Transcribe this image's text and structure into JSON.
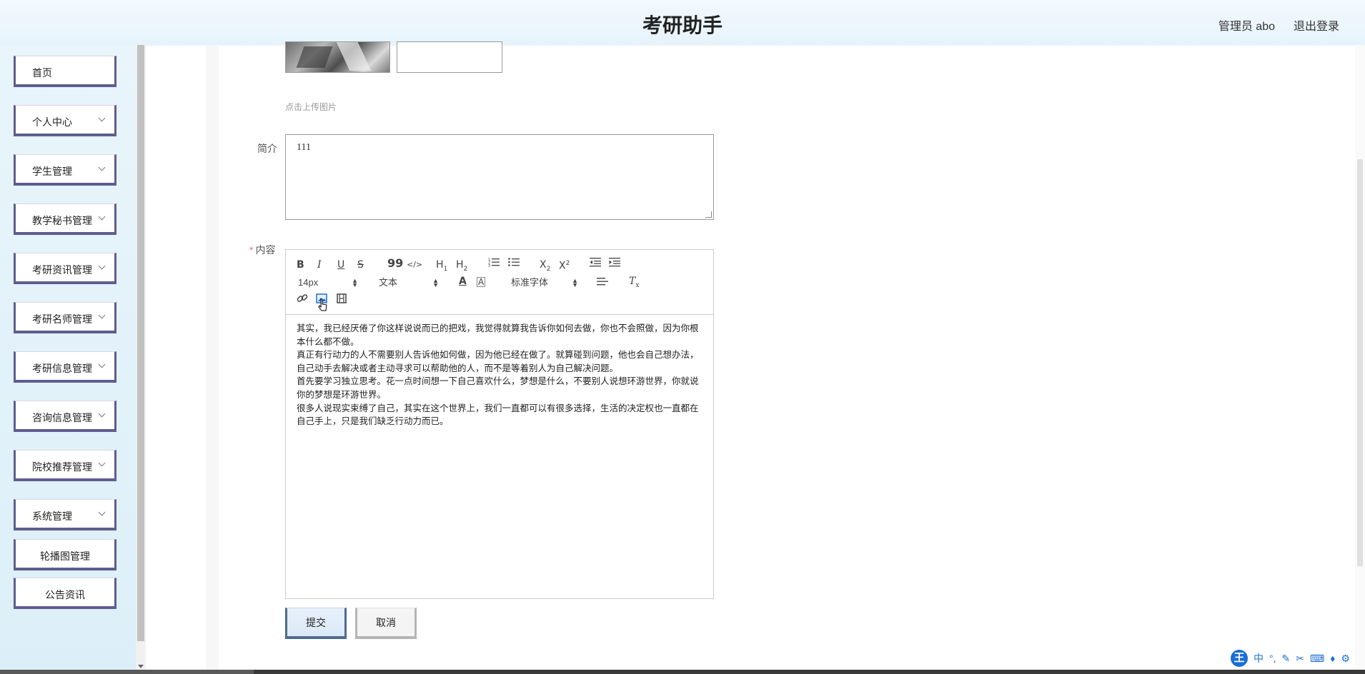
{
  "header": {
    "title": "考研助手",
    "user": "管理员 abo",
    "logout": "退出登录"
  },
  "sidebar": {
    "items": [
      {
        "label": "首页",
        "expandable": false
      },
      {
        "label": "个人中心",
        "expandable": true
      },
      {
        "label": "学生管理",
        "expandable": true
      },
      {
        "label": "教学秘书管理",
        "expandable": true
      },
      {
        "label": "考研资讯管理",
        "expandable": true
      },
      {
        "label": "考研名师管理",
        "expandable": true
      },
      {
        "label": "考研信息管理",
        "expandable": true
      },
      {
        "label": "咨询信息管理",
        "expandable": true
      },
      {
        "label": "院校推荐管理",
        "expandable": true
      },
      {
        "label": "系统管理",
        "expandable": true
      },
      {
        "label": "轮播图管理",
        "expandable": false
      },
      {
        "label": "公告资讯",
        "expandable": false
      }
    ]
  },
  "form": {
    "upload_hint": "点击上传图片",
    "intro_label": "简介",
    "intro_value": "111",
    "content_required": "*",
    "content_label": "内容",
    "submit_label": "提交",
    "cancel_label": "取消"
  },
  "editor": {
    "toolbar": {
      "bold": "B",
      "italic": "I",
      "underline": "U",
      "strike": "S",
      "quote": "99",
      "code": "</>",
      "h1": "H1",
      "h2": "H2",
      "subscript": "X2",
      "superscript": "X2",
      "font_size": "14px",
      "text_style": "文本",
      "font_family": "标准字体"
    },
    "paragraphs": [
      "其实，我已经厌倦了你这样说说而已的把戏，我觉得就算我告诉你如何去做，你也不会照做，因为你根本什么都不做。",
      "真正有行动力的人不需要别人告诉他如何做，因为他已经在做了。就算碰到问题，他也会自己想办法，自己动手去解决或者主动寻求可以帮助他的人，而不是等着别人为自己解决问题。",
      "首先要学习独立思考。花一点时间想一下自己喜欢什么，梦想是什么，不要别人说想环游世界，你就说你的梦想是环游世界。",
      "很多人说现实束缚了自己，其实在这个世界上，我们一直都可以有很多选择，生活的决定权也一直都在自己手上，只是我们缺乏行动力而已。"
    ]
  },
  "ime": {
    "logo": "王",
    "mode": "中"
  }
}
